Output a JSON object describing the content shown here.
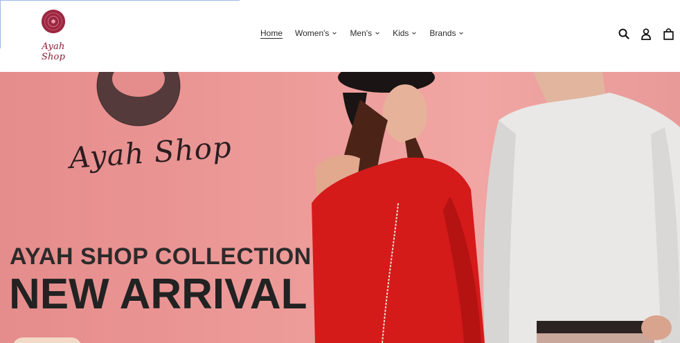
{
  "brand": {
    "logo_text": "Ayah Shop",
    "colors": {
      "accent": "#8a1d35",
      "hero_bg": "#ec9a98"
    }
  },
  "nav": {
    "items": [
      {
        "label": "Home",
        "active": true,
        "dropdown": false
      },
      {
        "label": "Women's",
        "active": false,
        "dropdown": true
      },
      {
        "label": "Men's",
        "active": false,
        "dropdown": true
      },
      {
        "label": "Kids",
        "active": false,
        "dropdown": true
      },
      {
        "label": "Brands",
        "active": false,
        "dropdown": true
      }
    ]
  },
  "header_icons": [
    "search-icon",
    "account-icon",
    "cart-icon"
  ],
  "hero": {
    "brand_script": "Ayah Shop",
    "subtitle": "AYAH SHOP COLLECTION",
    "title": "NEW ARRIVAL"
  }
}
